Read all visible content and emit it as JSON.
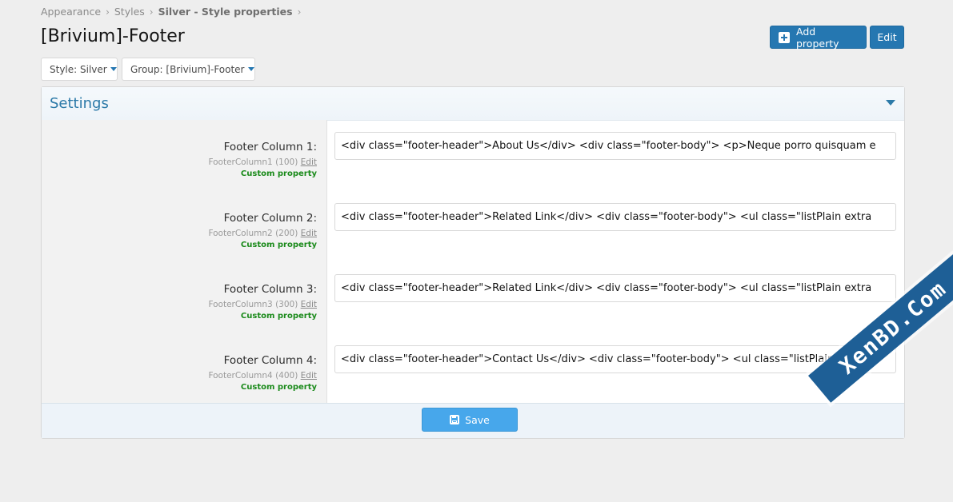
{
  "breadcrumb": {
    "items": [
      "Appearance",
      "Styles",
      "Silver - Style properties"
    ],
    "separator": "›"
  },
  "page": {
    "title": "[Brivium]-Footer"
  },
  "actions": {
    "add_property": "Add property",
    "edit": "Edit"
  },
  "filters": {
    "style": "Style: Silver",
    "group": "Group: [Brivium]-Footer"
  },
  "settings": {
    "title": "Settings",
    "rows": [
      {
        "label": "Footer Column 1:",
        "meta": "FooterColumn1 (100)",
        "edit": "Edit",
        "custom": "Custom property",
        "value": "<div class=\"footer-header\">About Us</div>   <div class=\"footer-body\">   <p>Neque porro quisquam e"
      },
      {
        "label": "Footer Column 2:",
        "meta": "FooterColumn2 (200)",
        "edit": "Edit",
        "custom": "Custom property",
        "value": "<div class=\"footer-header\">Related Link</div>   <div class=\"footer-body\">      <ul class=\"listPlain extra"
      },
      {
        "label": "Footer Column 3:",
        "meta": "FooterColumn3 (300)",
        "edit": "Edit",
        "custom": "Custom property",
        "value": "<div class=\"footer-header\">Related Link</div>   <div class=\"footer-body\">      <ul class=\"listPlain extra"
      },
      {
        "label": "Footer Column 4:",
        "meta": "FooterColumn4 (400)",
        "edit": "Edit",
        "custom": "Custom property",
        "value": "<div class=\"footer-header\">Contact Us</div>   <div class=\"footer-body\">        <ul class=\"listPlain conta"
      }
    ],
    "save": "Save"
  },
  "watermark": "XenBD.Com",
  "colors": {
    "primary": "#2577b1",
    "save": "#47a7eb",
    "custom": "#1a8a1a",
    "watermark": "#1e5f96"
  }
}
